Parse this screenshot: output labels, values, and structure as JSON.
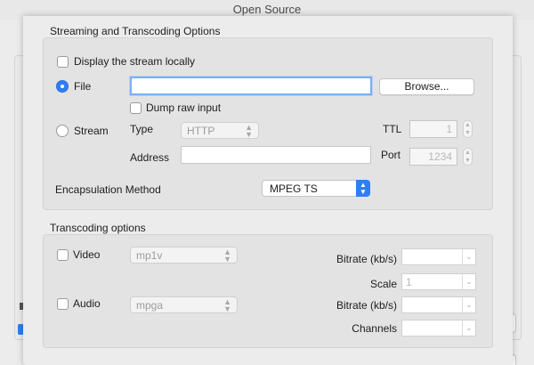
{
  "window": {
    "title": "Open Source"
  },
  "streaming": {
    "section_title": "Streaming and Transcoding Options",
    "display_locally_label": "Display the stream locally",
    "file": {
      "label": "File",
      "selected": true,
      "path_value": "",
      "browse_label": "Browse...",
      "dump_raw_label": "Dump raw input"
    },
    "stream": {
      "label": "Stream",
      "selected": false,
      "type_label": "Type",
      "type_value": "HTTP",
      "address_label": "Address",
      "address_value": "",
      "ttl_label": "TTL",
      "ttl_value": "1",
      "port_label": "Port",
      "port_value": "1234"
    },
    "encapsulation": {
      "label": "Encapsulation Method",
      "value": "MPEG TS"
    }
  },
  "transcoding": {
    "section_title": "Transcoding options",
    "video": {
      "label": "Video",
      "checked": false,
      "codec": "mp1v",
      "bitrate_label": "Bitrate (kb/s)",
      "bitrate_value": "",
      "scale_label": "Scale",
      "scale_value": "1"
    },
    "audio": {
      "label": "Audio",
      "checked": false,
      "codec": "mpga",
      "bitrate_label": "Bitrate (kb/s)",
      "bitrate_value": "",
      "channels_label": "Channels",
      "channels_value": ""
    }
  },
  "colors": {
    "accent": "#2f7ef6",
    "focus_ring": "#7aaef7",
    "panel": "#e3e3e3"
  },
  "icons": {
    "chevron": "chevron-updown-icon",
    "combo_arrow": "chevron-down-icon"
  }
}
